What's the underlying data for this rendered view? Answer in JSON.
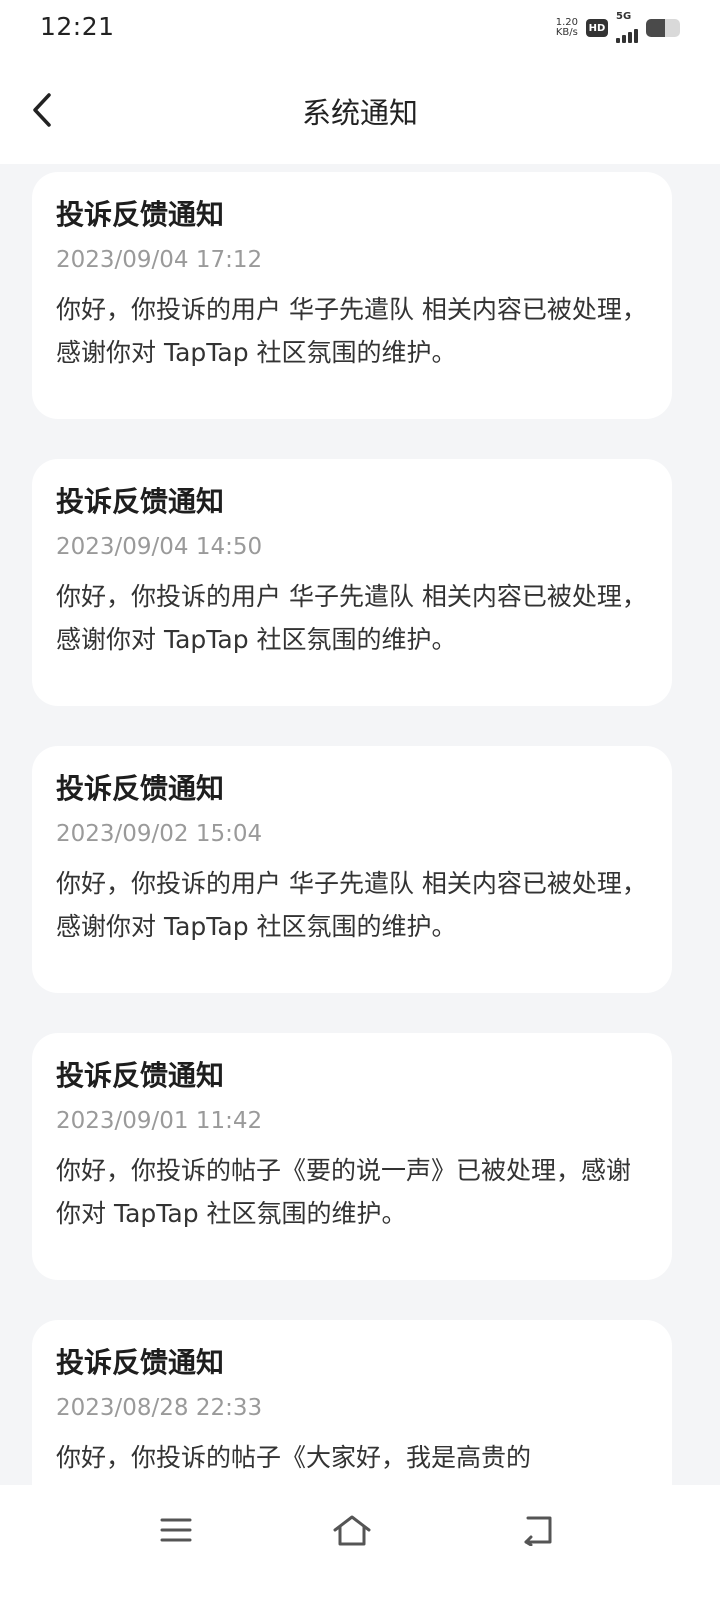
{
  "status_bar": {
    "time": "12:21",
    "net_speed_value": "1.20",
    "net_speed_unit": "KB/s",
    "hd_label": "HD",
    "network_label": "5G",
    "battery_level": 0.55
  },
  "header": {
    "title": "系统通知"
  },
  "notifications": [
    {
      "title": "投诉反馈通知",
      "time": "2023/09/04 17:12",
      "body": "你好，你投诉的用户 华子先遣队 相关内容已被处理，感谢你对 TapTap 社区氛围的维护。"
    },
    {
      "title": "投诉反馈通知",
      "time": "2023/09/04 14:50",
      "body": "你好，你投诉的用户 华子先遣队 相关内容已被处理，感谢你对 TapTap 社区氛围的维护。"
    },
    {
      "title": "投诉反馈通知",
      "time": "2023/09/02 15:04",
      "body": "你好，你投诉的用户 华子先遣队 相关内容已被处理，感谢你对 TapTap 社区氛围的维护。"
    },
    {
      "title": "投诉反馈通知",
      "time": "2023/09/01 11:42",
      "body": "你好，你投诉的帖子《要的说一声》已被处理，感谢你对 TapTap 社区氛围的维护。"
    },
    {
      "title": "投诉反馈通知",
      "time": "2023/08/28 22:33",
      "body": "你好，你投诉的帖子《大家好，我是高贵的"
    }
  ],
  "icons": {
    "back": "chevron-left-icon",
    "menu": "menu-icon",
    "home": "home-icon",
    "back_nav": "back-icon"
  }
}
